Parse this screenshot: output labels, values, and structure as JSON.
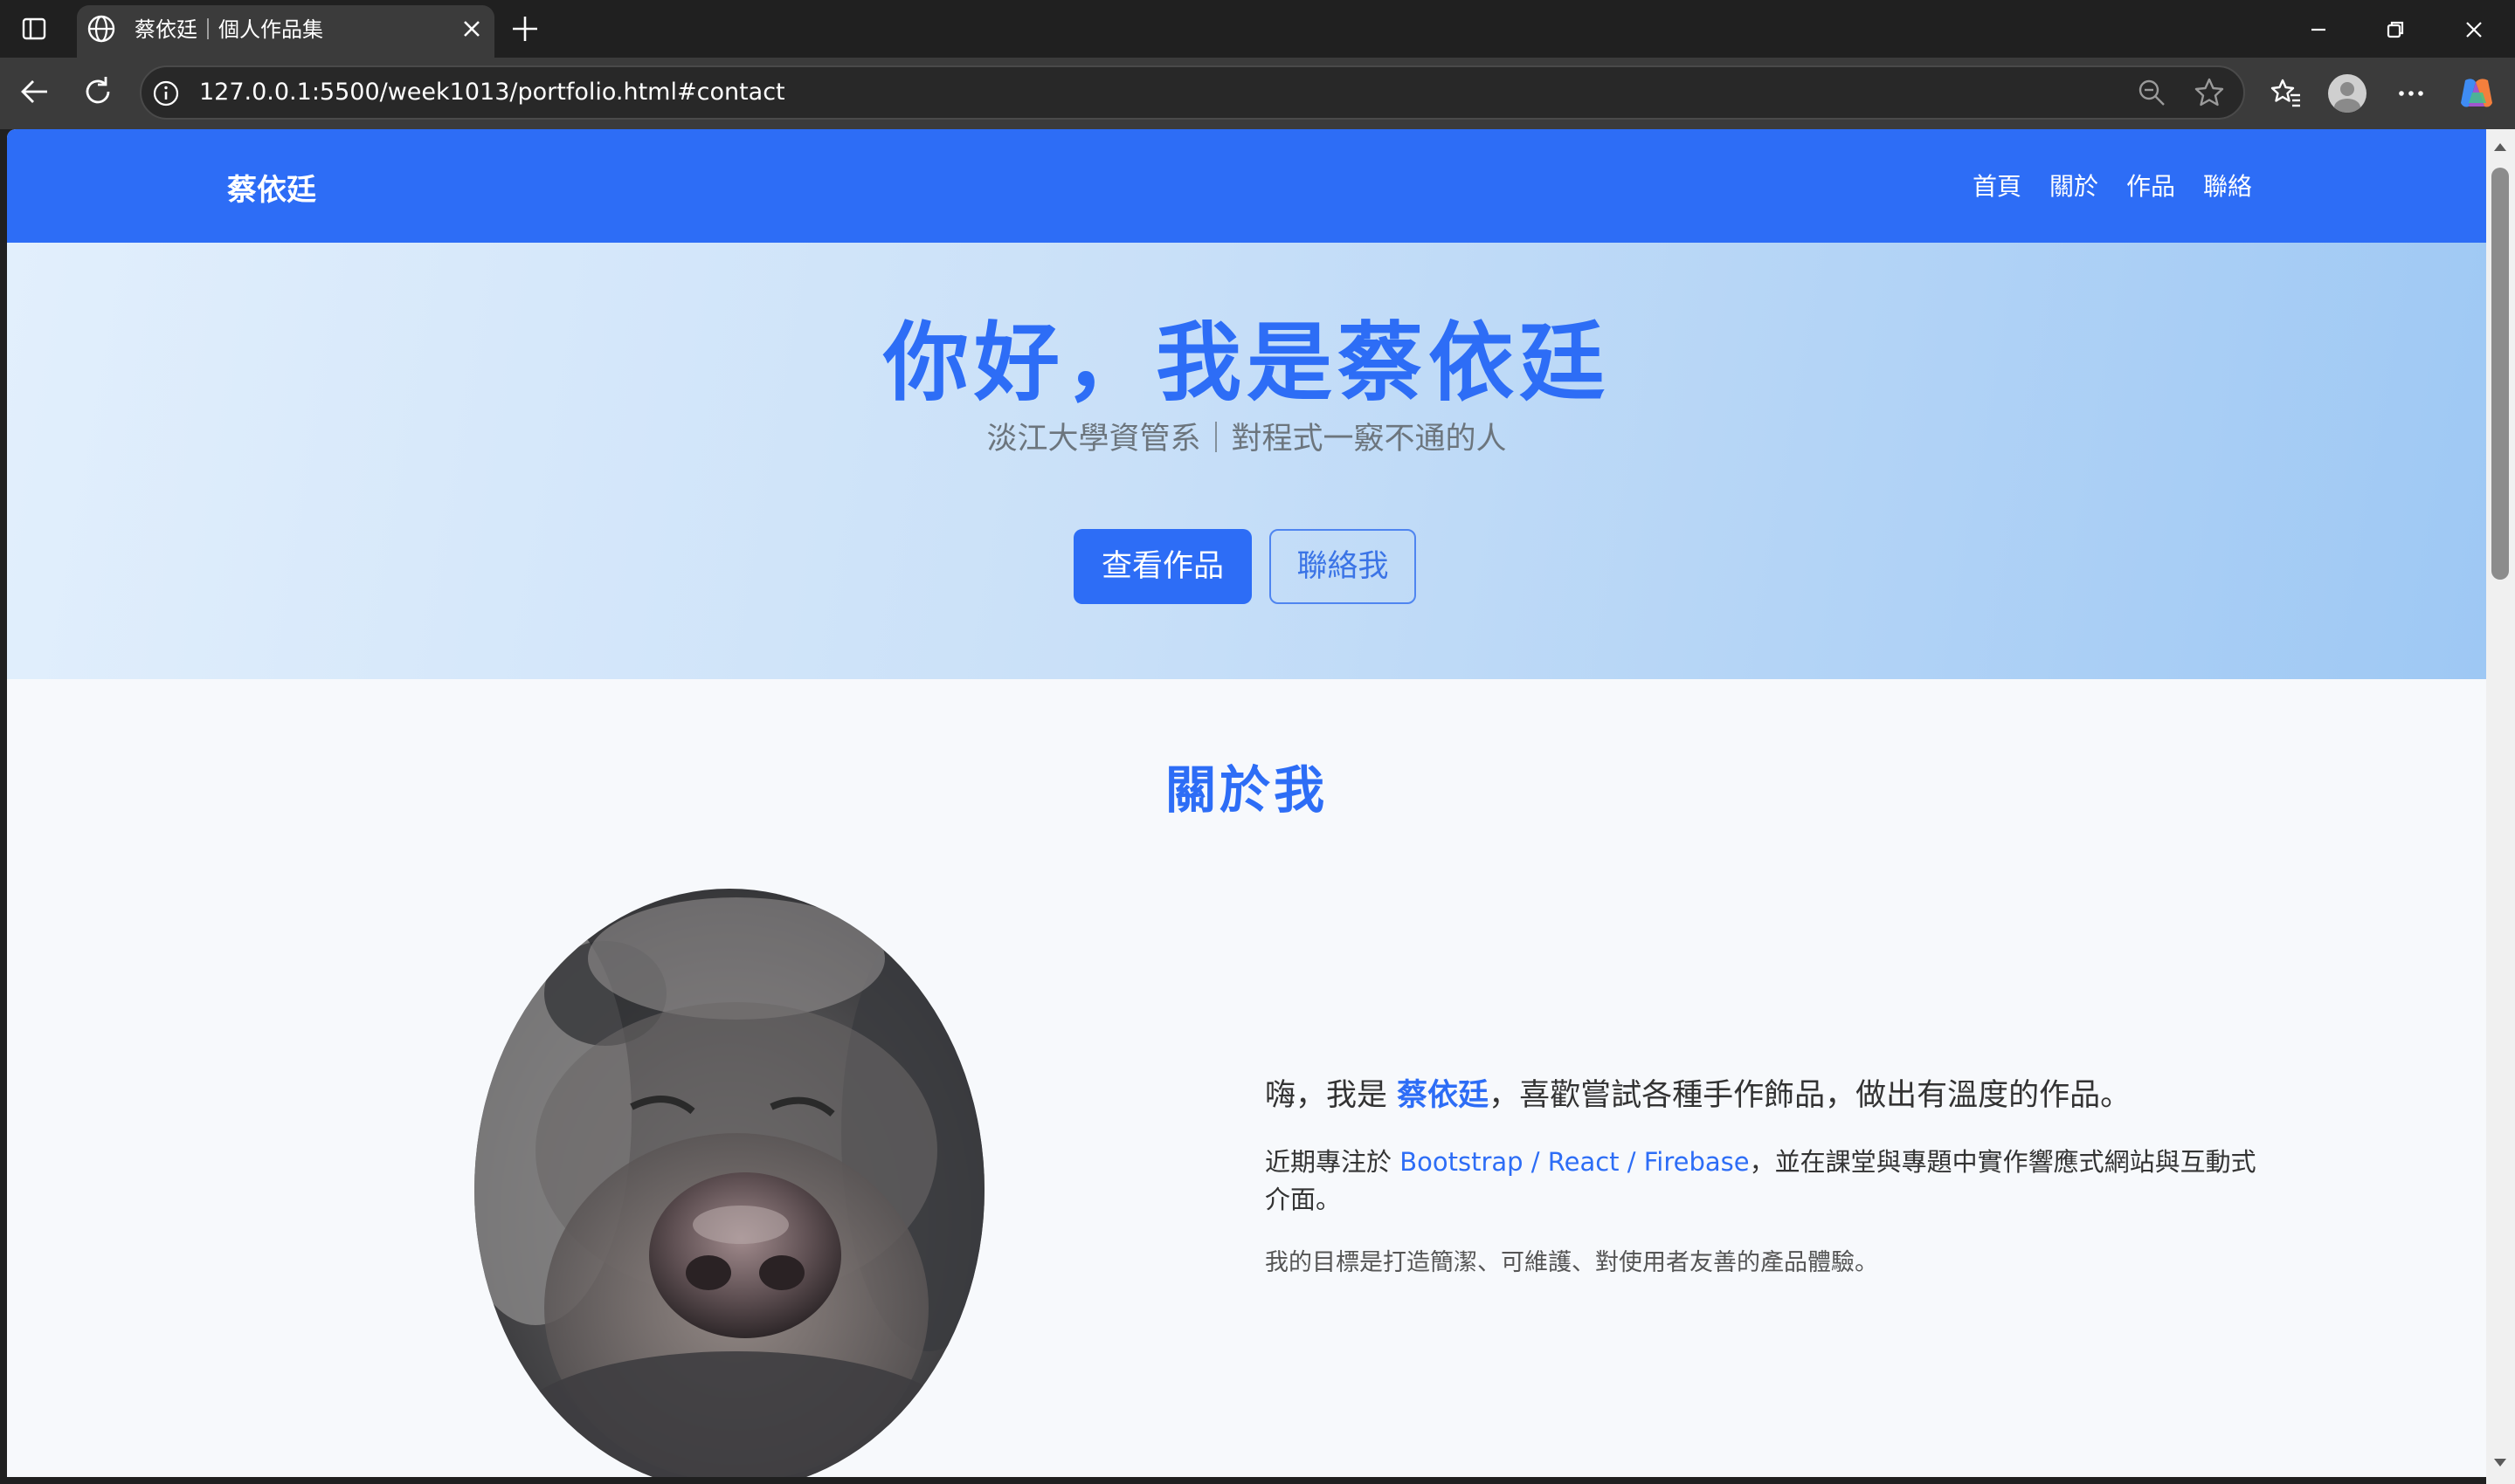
{
  "browser": {
    "tab_title": "蔡依廷｜個人作品集",
    "url": "127.0.0.1:5500/week1013/portfolio.html#contact",
    "icons": [
      "sidebar-toggle-icon",
      "globe-icon",
      "close-icon",
      "plus-icon",
      "minimize-icon",
      "restore-icon",
      "close-window-icon",
      "back-icon",
      "reload-icon",
      "info-icon",
      "zoom-out-icon",
      "star-icon",
      "favorites-icon",
      "profile-icon",
      "more-icon",
      "copilot-icon"
    ]
  },
  "site": {
    "brand": "蔡依廷",
    "nav": [
      "首頁",
      "關於",
      "作品",
      "聯絡"
    ],
    "accent_color": "#2d6df6"
  },
  "hero": {
    "title": "你好，我是蔡依廷",
    "subtitle": "淡江大學資管系｜對程式一竅不通的人",
    "primary_button": "查看作品",
    "secondary_button": "聯絡我"
  },
  "about": {
    "title": "關於我",
    "lead_prefix": "嗨，我是 ",
    "lead_name": "蔡依廷",
    "lead_suffix": "，喜歡嘗試各種手作飾品，做出有溫度的作品。",
    "p1_prefix": "近期專注於 ",
    "p1_link": "Bootstrap / React / Firebase",
    "p1_suffix": "，並在課堂與專題中實作響應式網站與互動式介面。",
    "p2": "我的目標是打造簡潔、可維護、對使用者友善的產品體驗。"
  }
}
